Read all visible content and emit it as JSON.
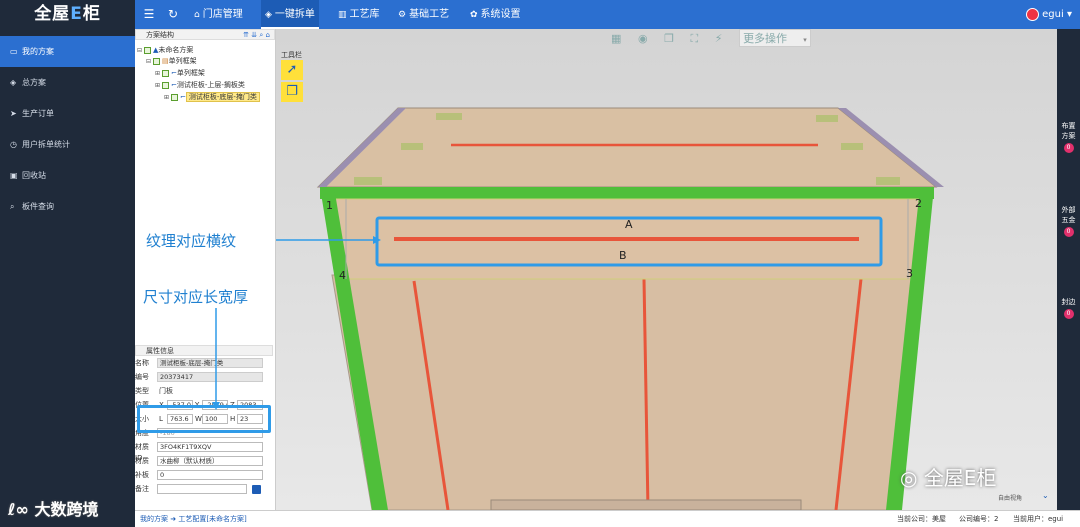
{
  "app": {
    "logo_pre": "全屋",
    "logo_accent": "E",
    "logo_post": "柜"
  },
  "topnav": {
    "items": [
      {
        "icon": "home-icon",
        "label": "门店管理"
      },
      {
        "icon": "shield-icon",
        "label": "一键拆单"
      },
      {
        "icon": "library-icon",
        "label": "工艺库"
      },
      {
        "icon": "gear-icon",
        "label": "基础工艺"
      },
      {
        "icon": "settings-icon",
        "label": "系统设置"
      }
    ],
    "user": "egui"
  },
  "sidebar": {
    "items": [
      {
        "icon": "monitor-icon",
        "label": "我的方案"
      },
      {
        "icon": "cube-icon",
        "label": "总方案"
      },
      {
        "icon": "send-icon",
        "label": "生产订单"
      },
      {
        "icon": "clock-icon",
        "label": "用户拆单统计"
      },
      {
        "icon": "trash-icon",
        "label": "回收站"
      },
      {
        "icon": "search-icon",
        "label": "板件查询"
      }
    ]
  },
  "tree": {
    "title": "方案结构",
    "nodes": [
      {
        "label": "未命名方案"
      },
      {
        "label": "单列框架"
      },
      {
        "label": "单列框架"
      },
      {
        "label": "测试柜板-上层-搁板类"
      },
      {
        "label": "测试柜板-底层-掩门类"
      }
    ]
  },
  "properties": {
    "title": "属性信息",
    "name_label": "名称",
    "name_value": "测试柜板-底层-掩门类",
    "code_label": "编号",
    "code_value": "20373417",
    "type_label": "类型",
    "type_value": "门板",
    "pos_label": "位置",
    "pos_x_label": "X",
    "pos_x": "-537.0",
    "pos_y_label": "Y",
    "pos_y": "-2019.6",
    "pos_z_label": "Z",
    "pos_z": "2083",
    "size_label": "大小",
    "l_label": "L",
    "l_value": "763.6",
    "w_label": "W",
    "w_value": "100",
    "h_label": "H",
    "h_value": "23",
    "angle_label": "角度",
    "angle_value": "-180",
    "material_id_label": "材质ID",
    "material_id_value": "3FO4KF1T9XQV",
    "material_label": "材质",
    "material_value": "水曲柳（默认材质）",
    "edge_label": "补板",
    "edge_value": "0",
    "note_label": "备注",
    "note_value": ""
  },
  "canvas": {
    "toolbar_label": "工具栏",
    "more_ops": "更多操作",
    "corner_labels": [
      "1",
      "2",
      "3",
      "4"
    ],
    "label_a": "A",
    "label_b": "B",
    "view_label": "自由视角"
  },
  "right_rail": {
    "items": [
      {
        "label": "布置方案",
        "badge": "0"
      },
      {
        "label": "外部五金",
        "badge": "0"
      },
      {
        "label": "封边",
        "badge": "0"
      }
    ]
  },
  "annotations": {
    "texture": "纹理对应横纹",
    "size": "尺寸对应长宽厚"
  },
  "statusbar": {
    "crumb1": "我的方案",
    "crumb2": "工艺配置[未命名方案]",
    "company_label": "当前公司：美屋",
    "company_no": "公司编号：2",
    "current_user": "当前用户：egui"
  },
  "watermark": {
    "left": "大数跨境",
    "right": "全屋E柜"
  },
  "colors": {
    "primary": "#2b6fd0",
    "sidebar_bg": "#1f2a3a",
    "panel_green": "#4fbf3a",
    "annotation_blue": "#2f9be8",
    "texture_line": "#e8553a"
  }
}
